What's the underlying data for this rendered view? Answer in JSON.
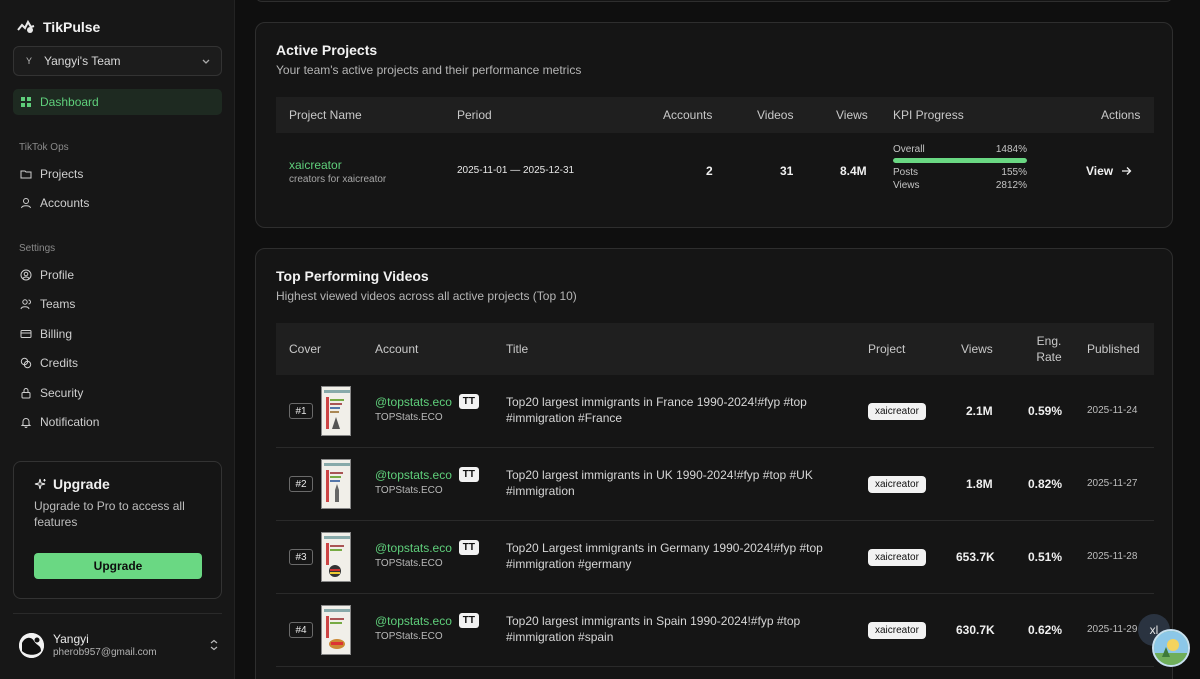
{
  "sidebar": {
    "brand": "TikPulse",
    "team": {
      "initial": "Y",
      "name": "Yangyi's Team"
    },
    "nav_dashboard": "Dashboard",
    "section_ops": "TikTok Ops",
    "nav_projects": "Projects",
    "nav_accounts": "Accounts",
    "section_settings": "Settings",
    "nav_profile": "Profile",
    "nav_teams": "Teams",
    "nav_billing": "Billing",
    "nav_credits": "Credits",
    "nav_security": "Security",
    "nav_notification": "Notification",
    "upgrade": {
      "title": "Upgrade",
      "desc": "Upgrade to Pro to access all features",
      "button": "Upgrade"
    },
    "user": {
      "name": "Yangyi",
      "email": "pherob957@gmail.com"
    }
  },
  "active_projects": {
    "title": "Active Projects",
    "subtitle": "Your team's active projects and their performance metrics",
    "headers": {
      "name": "Project Name",
      "period": "Period",
      "accounts": "Accounts",
      "videos": "Videos",
      "views": "Views",
      "kpi": "KPI Progress",
      "actions": "Actions"
    },
    "rows": [
      {
        "name": "xaicreator",
        "desc": "creators for xaicreator",
        "period": "2025-11-01 — 2025-12-31",
        "accounts": "2",
        "videos": "31",
        "views": "8.4M",
        "kpi_overall_label": "Overall",
        "kpi_overall": "1484%",
        "kpi_overall_fill": 1.0,
        "kpi_posts_label": "Posts",
        "kpi_posts": "155%",
        "kpi_views_label": "Views",
        "kpi_views": "2812%",
        "action": "View"
      }
    ]
  },
  "top_videos": {
    "title": "Top Performing Videos",
    "subtitle": "Highest viewed videos across all active projects (Top 10)",
    "headers": {
      "cover": "Cover",
      "account": "Account",
      "title": "Title",
      "project": "Project",
      "views": "Views",
      "eng_rate_line1": "Eng.",
      "eng_rate_line2": "Rate",
      "published": "Published"
    },
    "rows": [
      {
        "rank": "#1",
        "handle": "@topstats.eco",
        "platform": "TT",
        "account_name": "TOPStats.ECO",
        "title": "Top20 largest immigrants in France 1990-2024!#fyp #top #immigration #France",
        "project": "xaicreator",
        "views": "2.1M",
        "eng_rate": "0.59%",
        "published": "2025-11-24"
      },
      {
        "rank": "#2",
        "handle": "@topstats.eco",
        "platform": "TT",
        "account_name": "TOPStats.ECO",
        "title": "Top20 largest immigrants in UK 1990-2024!#fyp #top #UK #immigration",
        "project": "xaicreator",
        "views": "1.8M",
        "eng_rate": "0.82%",
        "published": "2025-11-27"
      },
      {
        "rank": "#3",
        "handle": "@topstats.eco",
        "platform": "TT",
        "account_name": "TOPStats.ECO",
        "title": "Top20 Largest immigrants in Germany 1990-2024!#fyp #top #immigration #germany",
        "project": "xaicreator",
        "views": "653.7K",
        "eng_rate": "0.51%",
        "published": "2025-11-28"
      },
      {
        "rank": "#4",
        "handle": "@topstats.eco",
        "platform": "TT",
        "account_name": "TOPStats.ECO",
        "title": "Top20 largest immigrants in Spain 1990-2024!#fyp #top #immigration #spain",
        "project": "xaicreator",
        "views": "630.7K",
        "eng_rate": "0.62%",
        "published": "2025-11-29"
      }
    ]
  },
  "chat_bubble": "xl",
  "colors": {
    "accent": "#6ad883",
    "link": "#5fcf7b",
    "background": "#0f0f0f",
    "card": "#151515"
  }
}
